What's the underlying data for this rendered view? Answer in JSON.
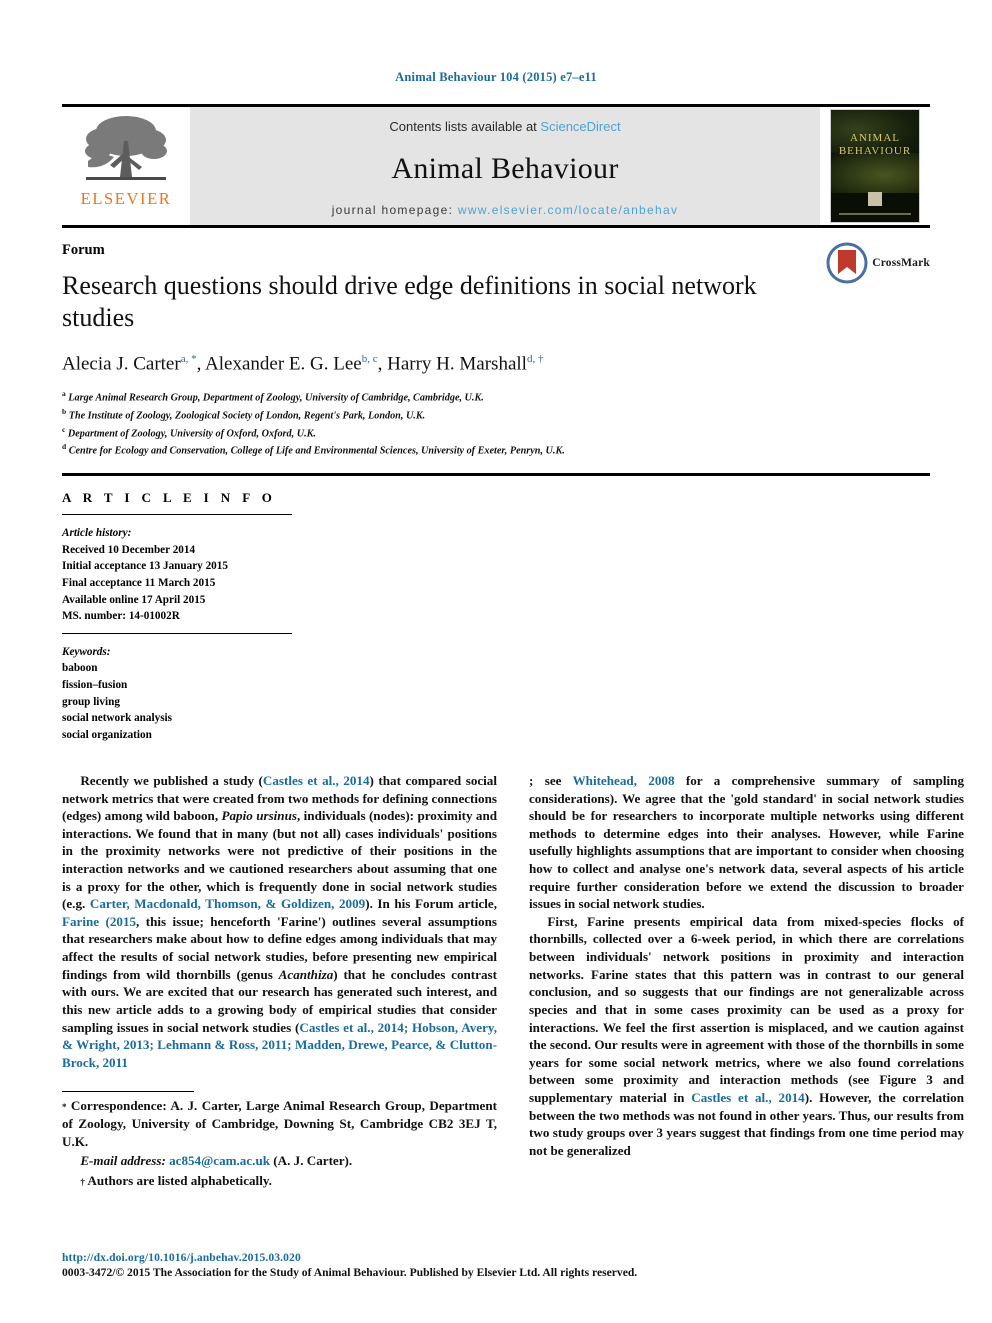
{
  "running_head": "Animal Behaviour 104 (2015) e7–e11",
  "masthead": {
    "publisher_logo_text": "ELSEVIER",
    "contents_prefix": "Contents lists available at ",
    "contents_link": "ScienceDirect",
    "journal_title": "Animal Behaviour",
    "homepage_prefix": "journal homepage: ",
    "homepage_url": "www.elsevier.com/locate/anbehav",
    "cover": {
      "line1": "ANIMAL",
      "line2": "BEHAVIOUR"
    }
  },
  "article": {
    "section_label": "Forum",
    "title": "Research questions should drive edge definitions in social network studies",
    "authors": "Alecia J. Carter a, *, Alexander E. G. Lee b, c, Harry H. Marshall d, †",
    "authors_parts": [
      {
        "name": "Alecia J. Carter",
        "marks": "a, *"
      },
      {
        "name": "Alexander E. G. Lee",
        "marks": "b, c"
      },
      {
        "name": "Harry H. Marshall",
        "marks": "d, †"
      }
    ],
    "affiliations": [
      {
        "mark": "a",
        "text": "Large Animal Research Group, Department of Zoology, University of Cambridge, Cambridge, U.K."
      },
      {
        "mark": "b",
        "text": "The Institute of Zoology, Zoological Society of London, Regent's Park, London, U.K."
      },
      {
        "mark": "c",
        "text": "Department of Zoology, University of Oxford, Oxford, U.K."
      },
      {
        "mark": "d",
        "text": "Centre for Ecology and Conservation, College of Life and Environmental Sciences, University of Exeter, Penryn, U.K."
      }
    ],
    "crossmark_label": "CrossMark"
  },
  "article_info": {
    "heading": "A R T I C L E   I N F O",
    "history_label": "Article history:",
    "history": [
      "Received 10 December 2014",
      "Initial acceptance 13 January 2015",
      "Final acceptance 11 March 2015",
      "Available online 17 April 2015",
      "MS. number: 14-01002R"
    ],
    "keywords_label": "Keywords:",
    "keywords": [
      "baboon",
      "fission–fusion",
      "group living",
      "social network analysis",
      "social organization"
    ]
  },
  "body": {
    "left_paragraph_1_a": "Recently we published a study (",
    "left_ref_1": "Castles et al., 2014",
    "left_paragraph_1_b": ") that compared social network metrics that were created from two methods for defining connections (edges) among wild baboon, ",
    "left_italic_1": "Papio ursinus",
    "left_paragraph_1_c": ", individuals (nodes): proximity and interactions. We found that in many (but not all) cases individuals' positions in the proximity networks were not predictive of their positions in the interaction networks and we cautioned researchers about assuming that one is a proxy for the other, which is frequently done in social network studies (e.g. ",
    "left_ref_2": "Carter, Macdonald, Thomson, & Goldizen, 2009",
    "left_paragraph_1_d": "). In his Forum article, ",
    "left_ref_3": "Farine (2015",
    "left_paragraph_1_e": ", this issue; henceforth 'Farine') outlines several assumptions that researchers make about how to define edges among individuals that may affect the results of social network studies, before presenting new empirical findings from wild thornbills (genus ",
    "left_italic_2": "Acanthiza",
    "left_paragraph_1_f": ") that he concludes contrast with ours. We are excited that our research has generated such interest, and this new article adds to a growing body of empirical studies that consider sampling issues in social network studies (",
    "left_ref_4": "Castles et al., 2014; Hobson, Avery, & Wright, 2013; Lehmann & Ross, 2011; Madden, Drewe, Pearce, & Clutton-Brock, 2011",
    "right_paragraph_1_a": "; see ",
    "right_ref_1": "Whitehead, 2008",
    "right_paragraph_1_b": " for a comprehensive summary of sampling considerations). We agree that the 'gold standard' in social network studies should be for researchers to incorporate multiple networks using different methods to determine edges into their analyses. However, while Farine usefully highlights assumptions that are important to consider when choosing how to collect and analyse one's network data, several aspects of his article require further consideration before we extend the discussion to broader issues in social network studies.",
    "right_paragraph_2_a": "First, Farine presents empirical data from mixed-species flocks of thornbills, collected over a 6-week period, in which there are correlations between individuals' network positions in proximity and interaction networks. Farine states that this pattern was in contrast to our general conclusion, and so suggests that our findings are not generalizable across species and that in some cases proximity can be used as a proxy for interactions. We feel the first assertion is misplaced, and we caution against the second. Our results were in agreement with those of the thornbills in some years for some social network metrics, where we also found correlations between some proximity and interaction methods (see Figure 3 and supplementary material in ",
    "right_ref_2": "Castles et al., 2014",
    "right_paragraph_2_b": "). However, the correlation between the two methods was not found in other years. Thus, our results from two study groups over 3 years suggest that findings from one time period may not be generalized"
  },
  "footnotes": {
    "correspondence_mark": "*",
    "correspondence": "Correspondence: A. J. Carter, Large Animal Research Group, Department of Zoology, University of Cambridge, Downing St, Cambridge CB2 3EJ T, U.K.",
    "email_label": "E-mail address:",
    "email": "ac854@cam.ac.uk",
    "email_suffix": "(A. J. Carter).",
    "dagger_mark": "†",
    "dagger_note": "Authors are listed alphabetically."
  },
  "bottom": {
    "doi": "http://dx.doi.org/10.1016/j.anbehav.2015.03.020",
    "copyright": "0003-3472/© 2015 The Association for the Study of Animal Behaviour. Published by Elsevier Ltd. All rights reserved."
  },
  "colors": {
    "link_blue": "#1a6c9c",
    "sciencedirect_blue": "#4ba3d3",
    "elsevier_orange": "#e87722",
    "masthead_grey": "#e4e4e4",
    "crossmark_red": "#c0392b"
  }
}
